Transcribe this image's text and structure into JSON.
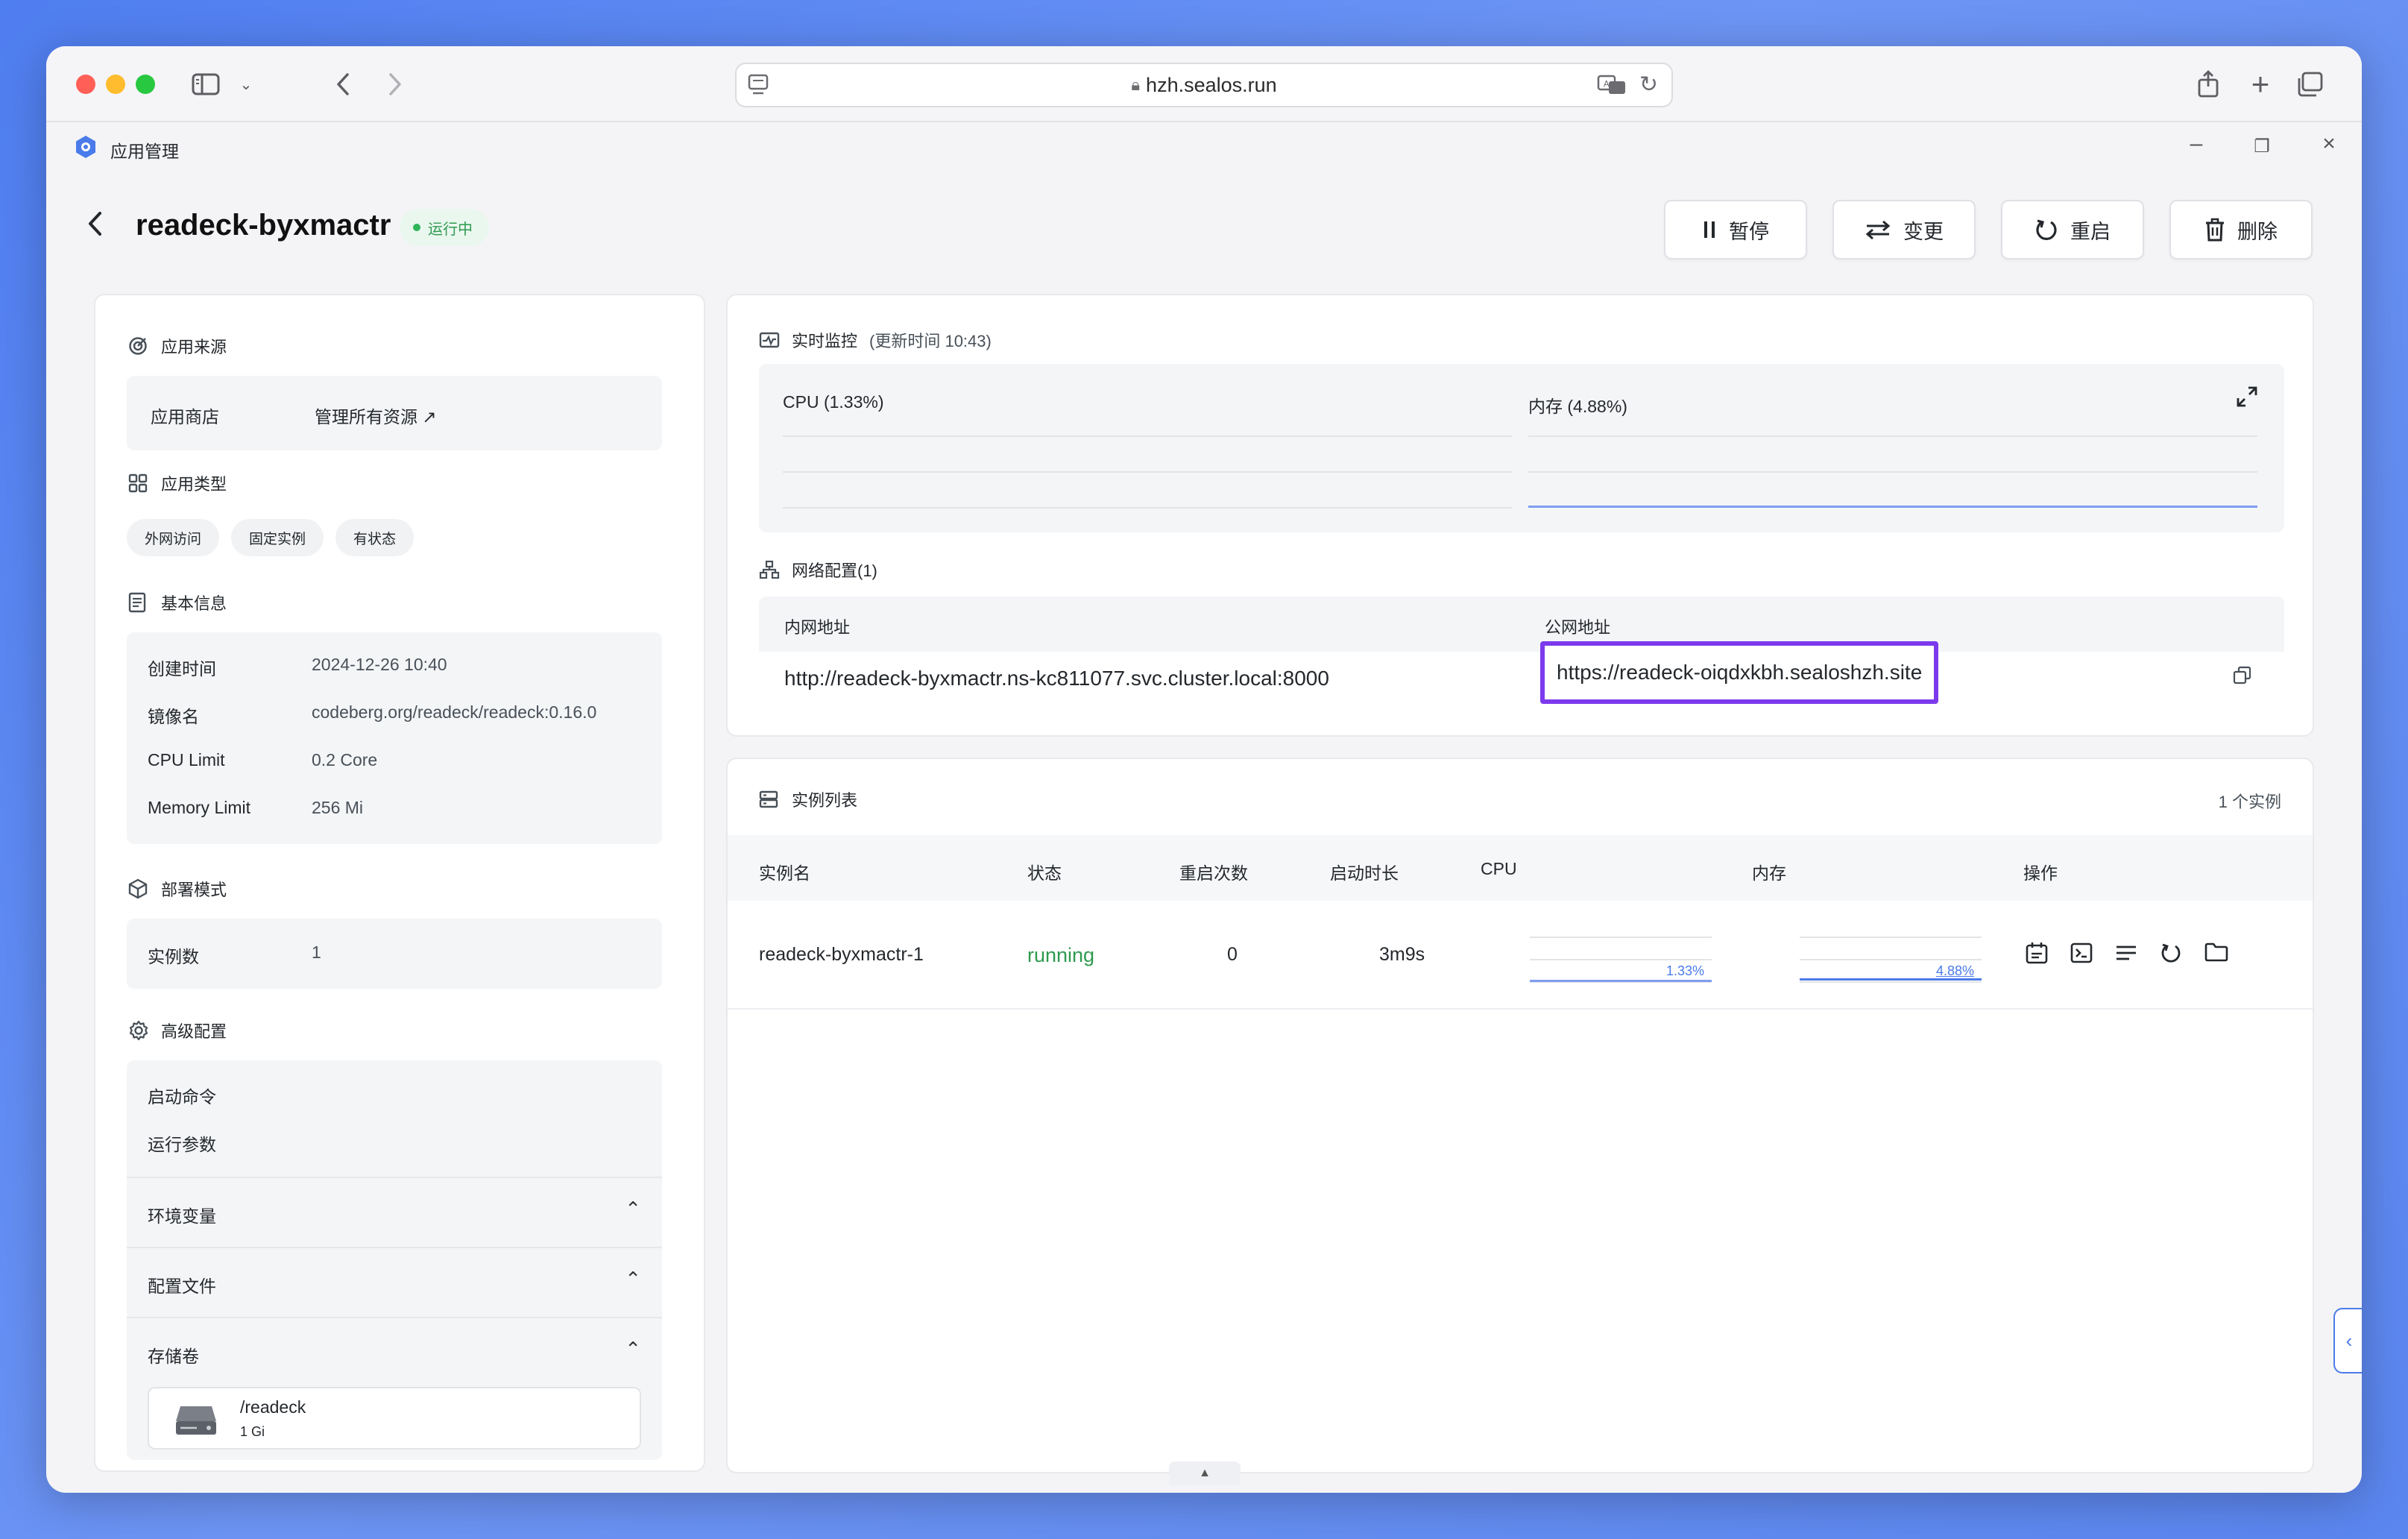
{
  "browser": {
    "url": "hzh.sealos.run"
  },
  "app": {
    "title": "应用管理"
  },
  "header": {
    "app_name": "readeck-byxmactr",
    "status": "运行中",
    "buttons": {
      "pause": "暂停",
      "change": "变更",
      "restart": "重启",
      "delete": "删除"
    }
  },
  "left": {
    "source": {
      "title": "应用来源",
      "key": "应用商店",
      "value": "管理所有资源"
    },
    "type": {
      "title": "应用类型",
      "tags": [
        "外网访问",
        "固定实例",
        "有状态"
      ]
    },
    "basic": {
      "title": "基本信息",
      "rows": [
        {
          "k": "创建时间",
          "v": "2024-12-26 10:40"
        },
        {
          "k": "镜像名",
          "v": "codeberg.org/readeck/readeck:0.16.0"
        },
        {
          "k": "CPU Limit",
          "v": "0.2 Core"
        },
        {
          "k": "Memory Limit",
          "v": "256 Mi"
        }
      ]
    },
    "deploy": {
      "title": "部署模式",
      "key": "实例数",
      "value": "1"
    },
    "advanced": {
      "title": "高级配置",
      "start_cmd": "启动命令",
      "run_args": "运行参数",
      "env": "环境变量",
      "config": "配置文件",
      "storage": "存储卷",
      "volume": {
        "path": "/readeck",
        "size": "1 Gi"
      }
    }
  },
  "monitor": {
    "title": "实时监控",
    "updated": "(更新时间  10:43)",
    "cpu_label": "CPU",
    "cpu_value": "(1.33%)",
    "mem_label": "内存",
    "mem_value": "(4.88%)"
  },
  "network": {
    "title": "网络配置(1)",
    "col_internal": "内网地址",
    "col_public": "公网地址",
    "internal": "http://readeck-byxmactr.ns-kc811077.svc.cluster.local:8000",
    "public": "https://readeck-oiqdxkbh.sealoshzh.site"
  },
  "instances": {
    "title": "实例列表",
    "count": "1 个实例",
    "columns": [
      "实例名",
      "状态",
      "重启次数",
      "启动时长",
      "CPU",
      "内存",
      "操作"
    ],
    "rows": [
      {
        "name": "readeck-byxmactr-1",
        "status": "running",
        "restarts": "0",
        "uptime": "3m9s",
        "cpu": "1.33%",
        "cpu_level": 0.0133,
        "mem": "4.88%",
        "mem_level": 0.0488
      }
    ]
  },
  "colors": {
    "accent": "#4a7bea",
    "running": "#2e9a4f",
    "highlight": "#7c3aed"
  }
}
